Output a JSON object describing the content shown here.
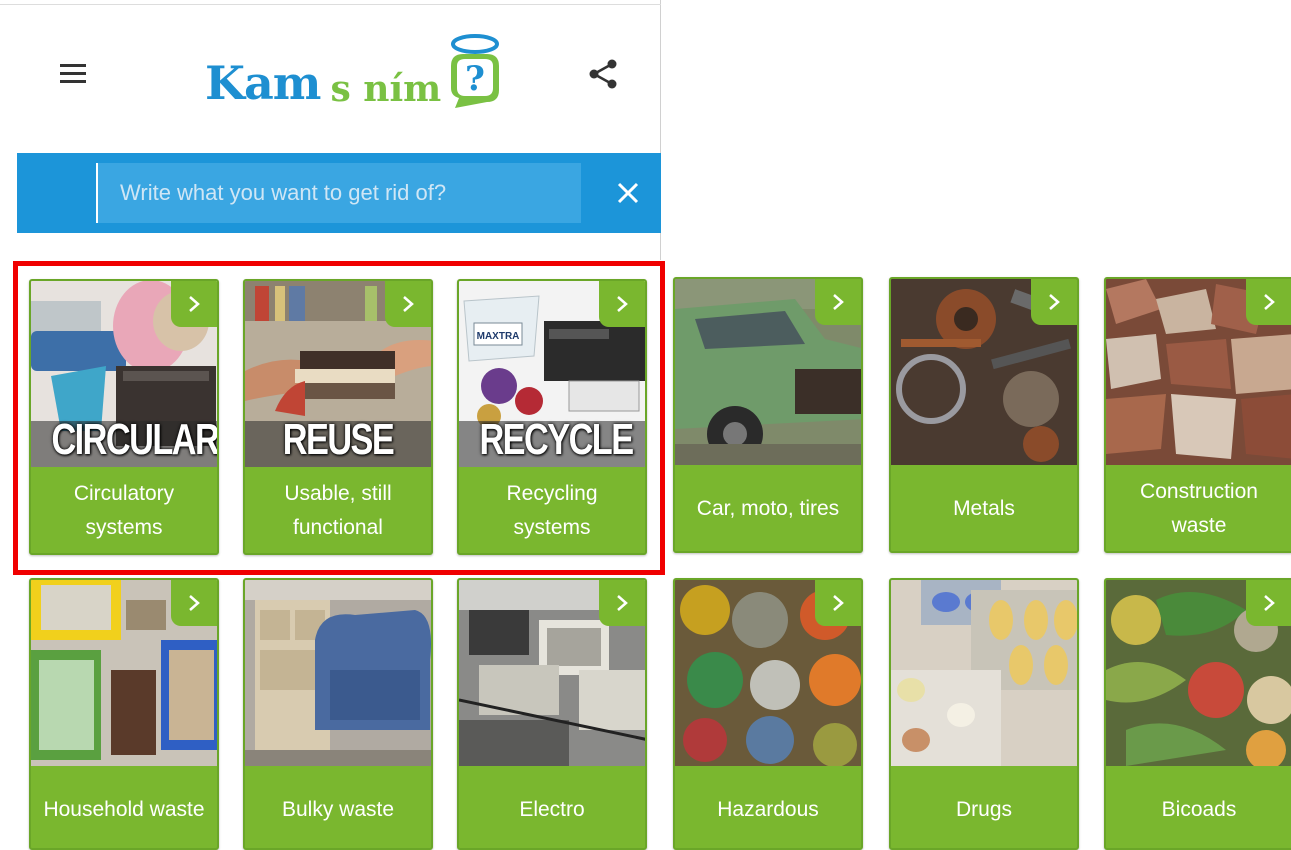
{
  "header": {
    "logo_kam": "Kam",
    "logo_snim": "s ním",
    "logo_q": "?"
  },
  "search": {
    "placeholder": "Write what you want to get rid of?"
  },
  "icons": {
    "menu": "menu-icon",
    "share": "share-icon",
    "clear": "close-icon",
    "arrow": "chevron-right-icon"
  },
  "colors": {
    "brand_blue": "#1e8fd1",
    "brand_green": "#7ac143",
    "tile_green": "#7ab72f",
    "search_bar": "#1c95d9",
    "highlight": "#f00000"
  },
  "categories": [
    {
      "label": "Circulatory systems",
      "overlay": "CIRCULAR"
    },
    {
      "label": "Usable, still functional",
      "overlay": "REUSE"
    },
    {
      "label": "Recycling systems",
      "overlay": "RECYCLE"
    },
    {
      "label": "Car, moto, tires"
    },
    {
      "label": "Metals"
    },
    {
      "label": "Construction waste"
    },
    {
      "label": "Household waste"
    },
    {
      "label": "Bulky waste"
    },
    {
      "label": "Electro"
    },
    {
      "label": "Hazardous"
    },
    {
      "label": "Drugs"
    },
    {
      "label": "Bicoads"
    }
  ]
}
